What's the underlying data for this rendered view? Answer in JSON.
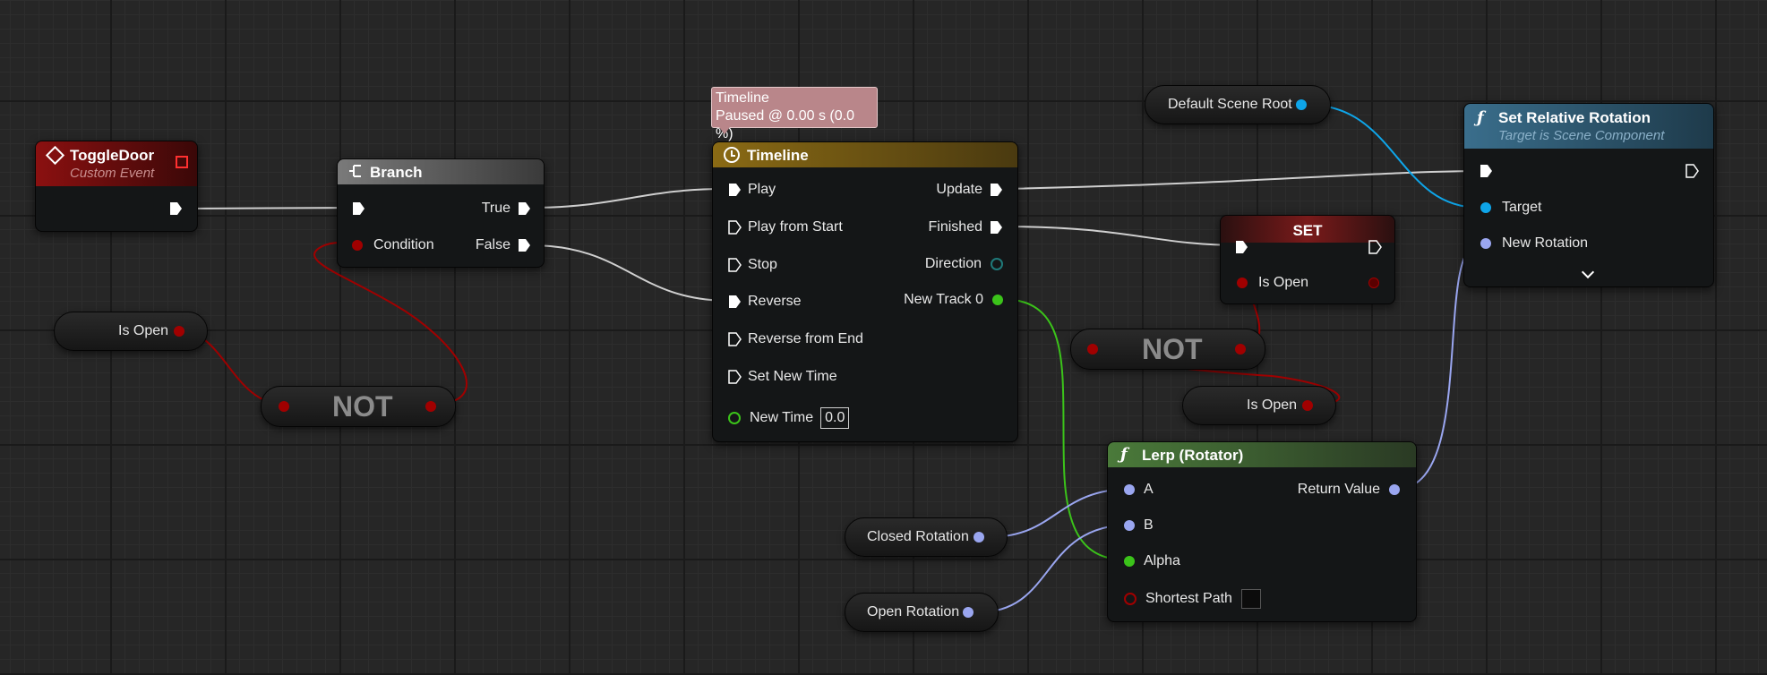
{
  "colors": {
    "exec": "#ffffff",
    "bool": "#a00000",
    "object": "#0ea5e9",
    "rotator": "#9aa6f0",
    "float": "#3bc31a",
    "direction": "#1f7a7a",
    "event_header": "#8b1010",
    "branch_header": "#6a6a6a",
    "timeline_header": "#8a6a14",
    "function_header": "#3a6e8c",
    "lerp_header": "#4a7a3a",
    "set_header": "#7a1a1a"
  },
  "toggle_door": {
    "title": "ToggleDoor",
    "subtitle": "Custom Event",
    "icon": "event-diamond-icon",
    "delegate_icon": "delegate-square-icon"
  },
  "branch": {
    "title": "Branch",
    "icon": "branch-icon",
    "pin_true": "True",
    "pin_false": "False",
    "pin_condition": "Condition"
  },
  "is_open_getter_1": {
    "label": "Is Open"
  },
  "not_1": {
    "label": "NOT"
  },
  "timeline_tooltip": {
    "line1": "Timeline",
    "line2": "Paused @ 0.00 s (0.0 %)"
  },
  "timeline": {
    "title": "Timeline",
    "icon": "clock-icon",
    "inputs": [
      "Play",
      "Play from Start",
      "Stop",
      "Reverse",
      "Reverse from End",
      "Set New Time"
    ],
    "new_time_label": "New Time",
    "new_time_value": "0.0",
    "outputs": [
      "Update",
      "Finished",
      "Direction",
      "New Track 0"
    ]
  },
  "default_scene_root": {
    "label": "Default Scene Root"
  },
  "set_node": {
    "title": "SET",
    "pin_label": "Is Open"
  },
  "not_2": {
    "label": "NOT"
  },
  "is_open_getter_2": {
    "label": "Is Open"
  },
  "set_relative_rotation": {
    "title": "Set Relative Rotation",
    "subtitle": "Target is Scene Component",
    "icon": "function-icon",
    "pin_target": "Target",
    "pin_new_rotation": "New Rotation",
    "expand_icon": "chevron-down-icon"
  },
  "lerp": {
    "title": "Lerp (Rotator)",
    "icon": "function-icon",
    "pin_a": "A",
    "pin_b": "B",
    "pin_alpha": "Alpha",
    "pin_shortest_path": "Shortest Path",
    "pin_return": "Return Value"
  },
  "closed_rotation": {
    "label": "Closed Rotation"
  },
  "open_rotation": {
    "label": "Open Rotation"
  }
}
